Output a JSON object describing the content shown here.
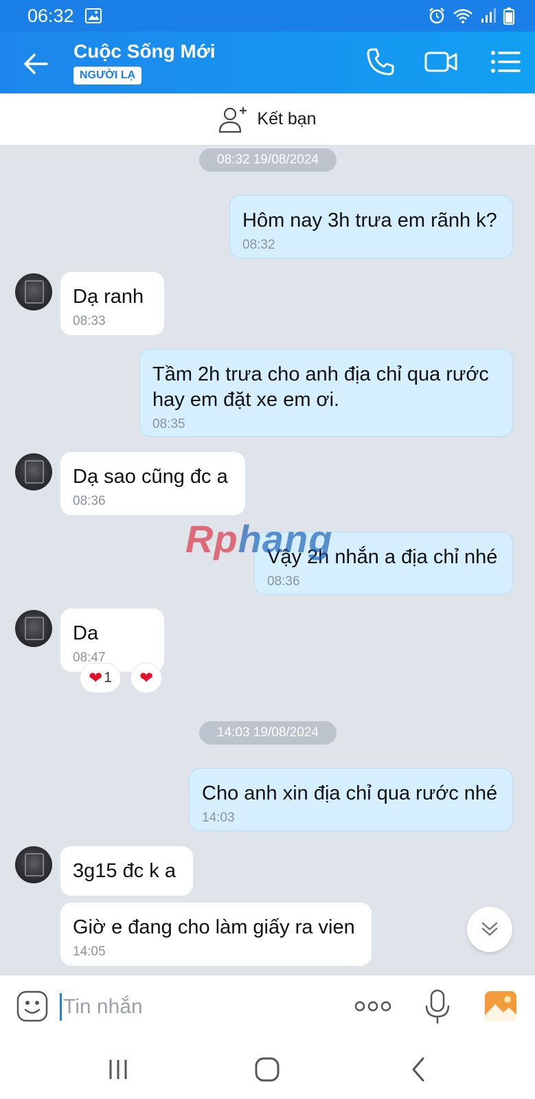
{
  "status_bar": {
    "time": "06:32"
  },
  "header": {
    "title": "Cuộc Sống Mới",
    "badge": "NGƯỜI LẠ",
    "icons": [
      "back-arrow-icon",
      "phone-icon",
      "video-camera-icon",
      "menu-list-icon"
    ]
  },
  "add_friend": {
    "label": "Kết bạn",
    "icon": "add-user-icon"
  },
  "chat": {
    "timestamp_1": "08:32 19/08/2024",
    "timestamp_2": "14:03 19/08/2024",
    "messages": [
      {
        "dir": "out",
        "text": "Hôm nay 3h trưa em rãnh k?",
        "time": "08:32"
      },
      {
        "dir": "in",
        "text": "Dạ ranh",
        "time": "08:33"
      },
      {
        "dir": "out",
        "text": "Tầm 2h trưa cho anh địa chỉ qua rước hay em đặt xe em ơi.",
        "time": "08:35"
      },
      {
        "dir": "in",
        "text": "Dạ sao cũng đc a",
        "time": "08:36"
      },
      {
        "dir": "out",
        "text": "Vậy 2h nhắn a địa chỉ nhé",
        "time": "08:36"
      },
      {
        "dir": "in",
        "text": "Da",
        "time": "08:47"
      },
      {
        "dir": "out",
        "text": "Cho anh xin địa chỉ qua rước nhé",
        "time": "14:03"
      },
      {
        "dir": "in",
        "text": "3g15 đc k a",
        "time": ""
      },
      {
        "dir": "in",
        "text": "Giờ e đang cho làm giấy ra vien",
        "time": "14:05"
      }
    ],
    "reaction_count": "1",
    "heart": "❤"
  },
  "watermark": {
    "part1": "Rp",
    "part2": "hang"
  },
  "input": {
    "placeholder": "Tin nhắn"
  },
  "colors": {
    "accent": "#1a7fe6",
    "outgoing_bubble": "#d5efff",
    "background": "#dfe4eb"
  }
}
